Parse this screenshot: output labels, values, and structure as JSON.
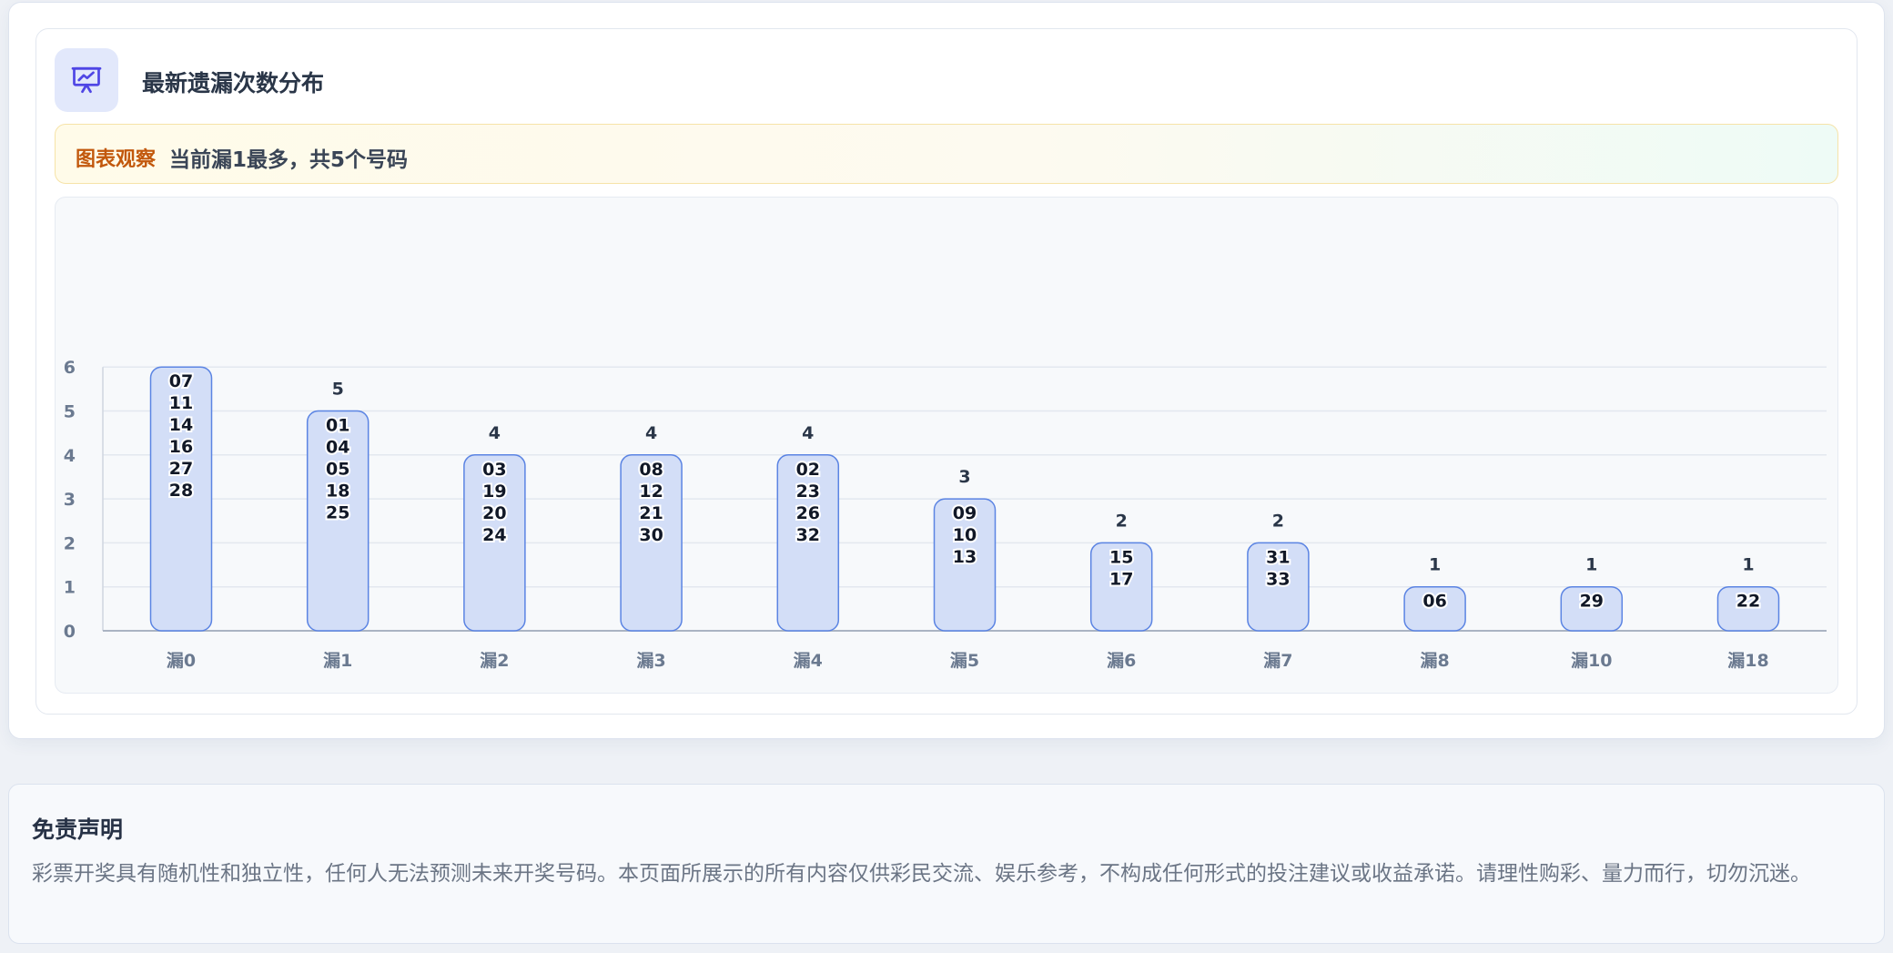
{
  "card": {
    "title": "最新遗漏次数分布",
    "icon": "presentation-chart-icon"
  },
  "observation": {
    "tag": "图表观察",
    "text": "当前漏1最多，共5个号码"
  },
  "colors": {
    "bar_fill": "#d3def7",
    "bar_stroke": "#5b84e3",
    "tag": "#c2580c",
    "axis_text": "#6b7a90"
  },
  "chart_data": {
    "type": "bar",
    "categories": [
      "漏0",
      "漏1",
      "漏2",
      "漏3",
      "漏4",
      "漏5",
      "漏6",
      "漏7",
      "漏8",
      "漏10",
      "漏18"
    ],
    "values": [
      6,
      5,
      4,
      4,
      4,
      3,
      2,
      2,
      1,
      1,
      1
    ],
    "value_labels": [
      "",
      "5",
      "4",
      "4",
      "4",
      "3",
      "2",
      "2",
      "1",
      "1",
      "1"
    ],
    "numbers": [
      [
        "07",
        "11",
        "14",
        "16",
        "27",
        "28"
      ],
      [
        "01",
        "04",
        "05",
        "18",
        "25"
      ],
      [
        "03",
        "19",
        "20",
        "24"
      ],
      [
        "08",
        "12",
        "21",
        "30"
      ],
      [
        "02",
        "23",
        "26",
        "32"
      ],
      [
        "09",
        "10",
        "13"
      ],
      [
        "15",
        "17"
      ],
      [
        "31",
        "33"
      ],
      [
        "06"
      ],
      [
        "29"
      ],
      [
        "22"
      ]
    ],
    "yticks": [
      0,
      1,
      2,
      3,
      4,
      5,
      6
    ],
    "ylim": [
      0,
      6
    ],
    "grid": true
  },
  "disclaimer": {
    "title": "免责声明",
    "text": "彩票开奖具有随机性和独立性，任何人无法预测未来开奖号码。本页面所展示的所有内容仅供彩民交流、娱乐参考，不构成任何形式的投注建议或收益承诺。请理性购彩、量力而行，切勿沉迷。"
  }
}
